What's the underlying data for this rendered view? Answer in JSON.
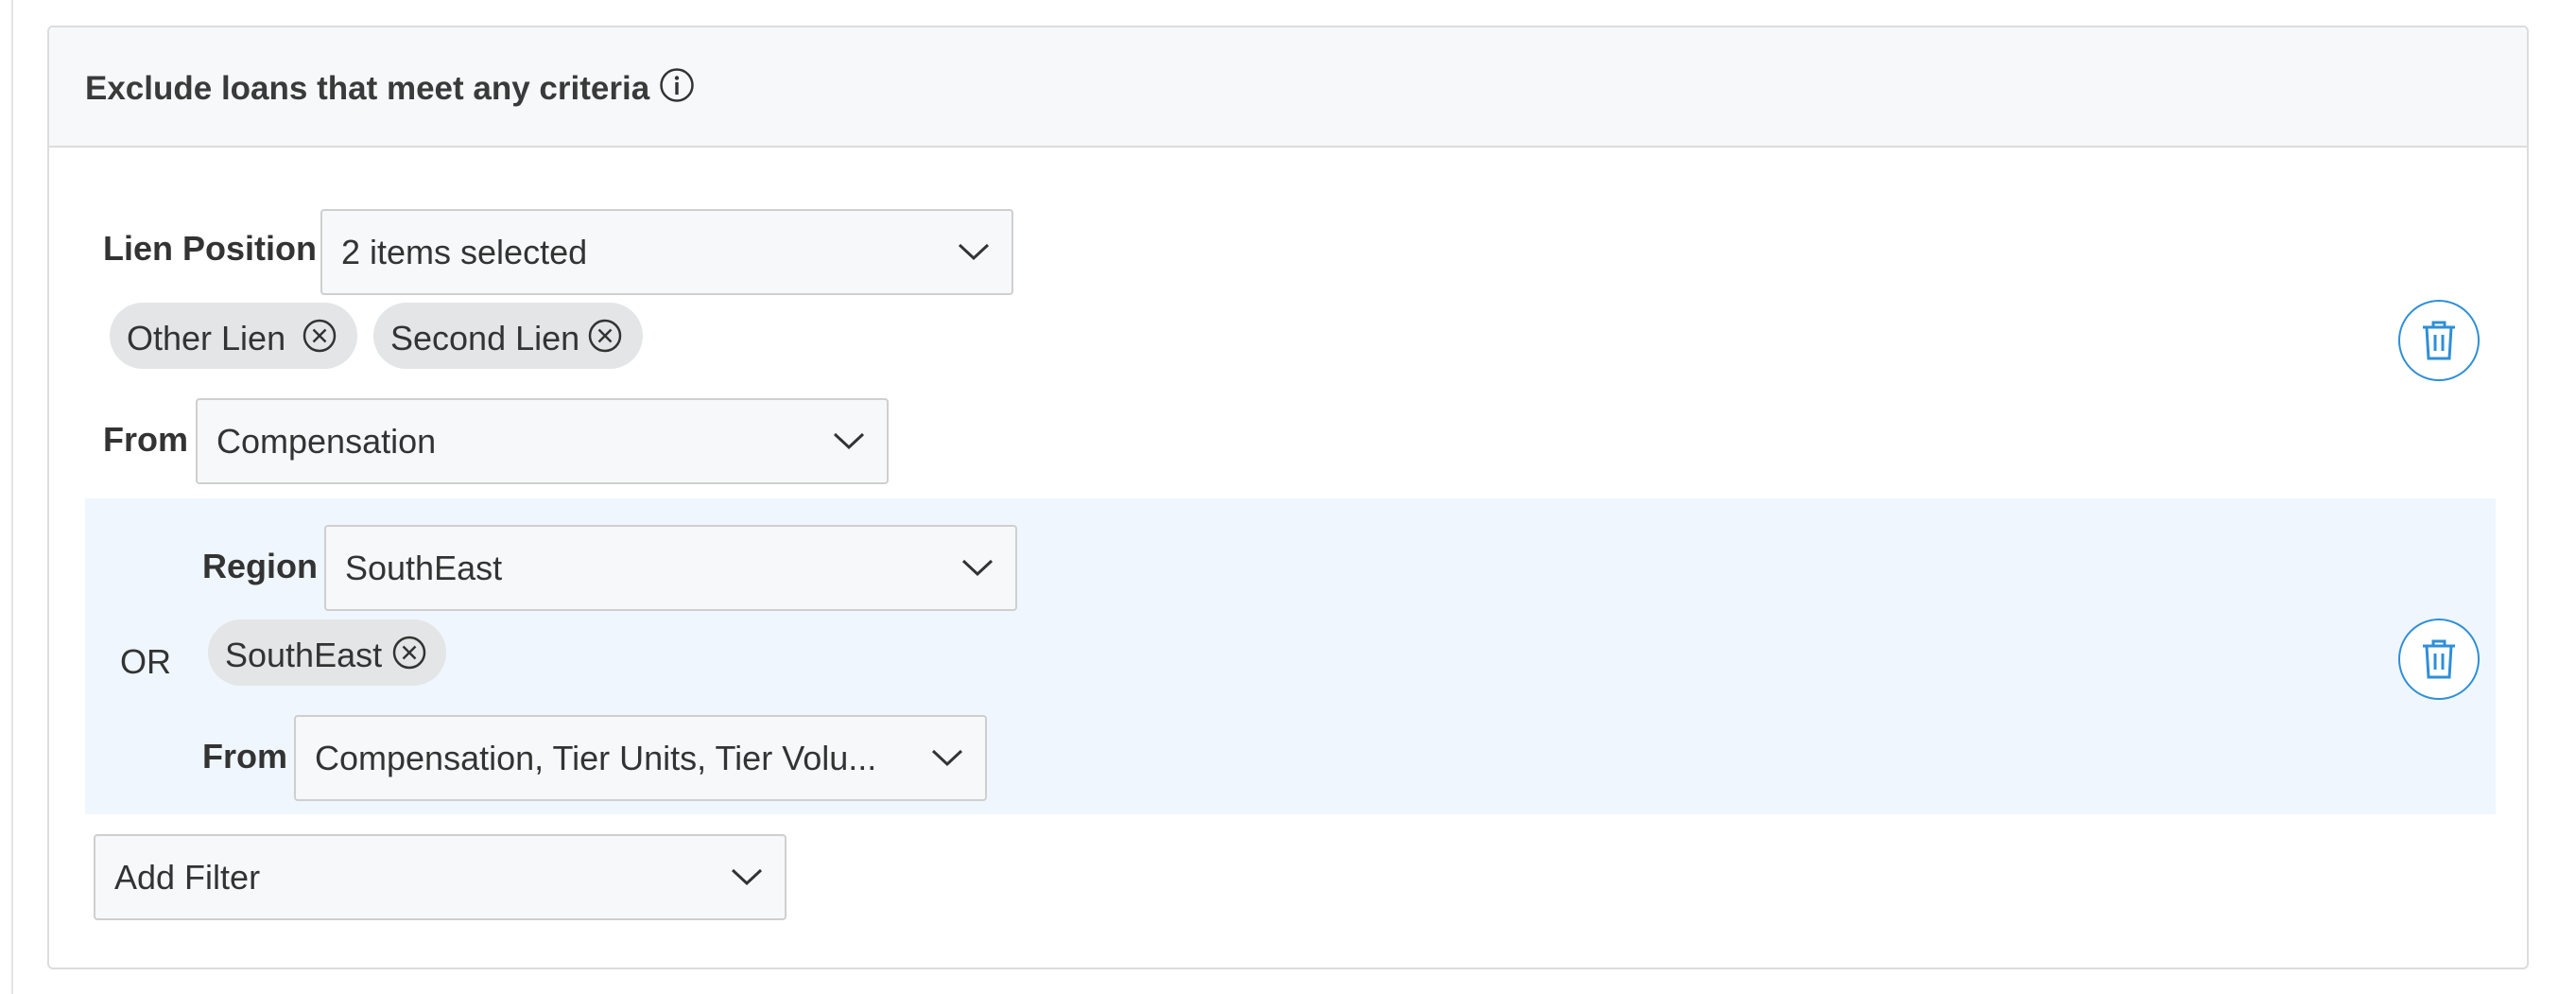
{
  "panel": {
    "title": "Exclude loans that meet any criteria"
  },
  "filters": [
    {
      "label": "Lien Position",
      "value": "2 items selected",
      "chips": [
        "Other Lien",
        "Second Lien"
      ],
      "from_label": "From",
      "from_value": "Compensation"
    },
    {
      "connector": "OR",
      "label": "Region",
      "value": "SouthEast",
      "chips": [
        "SouthEast"
      ],
      "from_label": "From",
      "from_value": "Compensation, Tier Units, Tier Volu..."
    }
  ],
  "add_filter": {
    "label": "Add Filter"
  },
  "colors": {
    "accent": "#2f8fd8",
    "band": "#eff6fd",
    "chip": "#e4e5e6"
  }
}
